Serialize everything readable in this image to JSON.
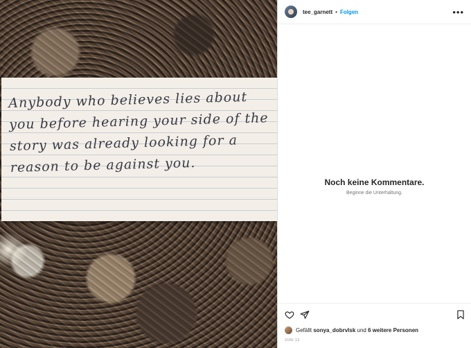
{
  "post": {
    "photo": {
      "note_text": "Anybody who believes lies about you before hearing your side of the story was already looking for a reason to be against you."
    },
    "header": {
      "username": "tee_garnett",
      "separator": "•",
      "follow_label": "Folgen",
      "more_icon": "more-horizontal-icon"
    },
    "comments": {
      "empty_title": "Noch keine Kommentare.",
      "empty_subtitle": "Beginne die Unterhaltung."
    },
    "actions": {
      "like_icon": "heart-icon",
      "share_icon": "paper-plane-icon",
      "save_icon": "bookmark-icon"
    },
    "likes": {
      "prefix": "Gefällt",
      "first_user": "sonya_dobrvlsk",
      "suffix": "und",
      "others": "6 weitere Personen"
    },
    "date": "JUNI 13"
  },
  "colors": {
    "accent": "#0095f6",
    "text": "#262626",
    "muted": "#737373"
  }
}
